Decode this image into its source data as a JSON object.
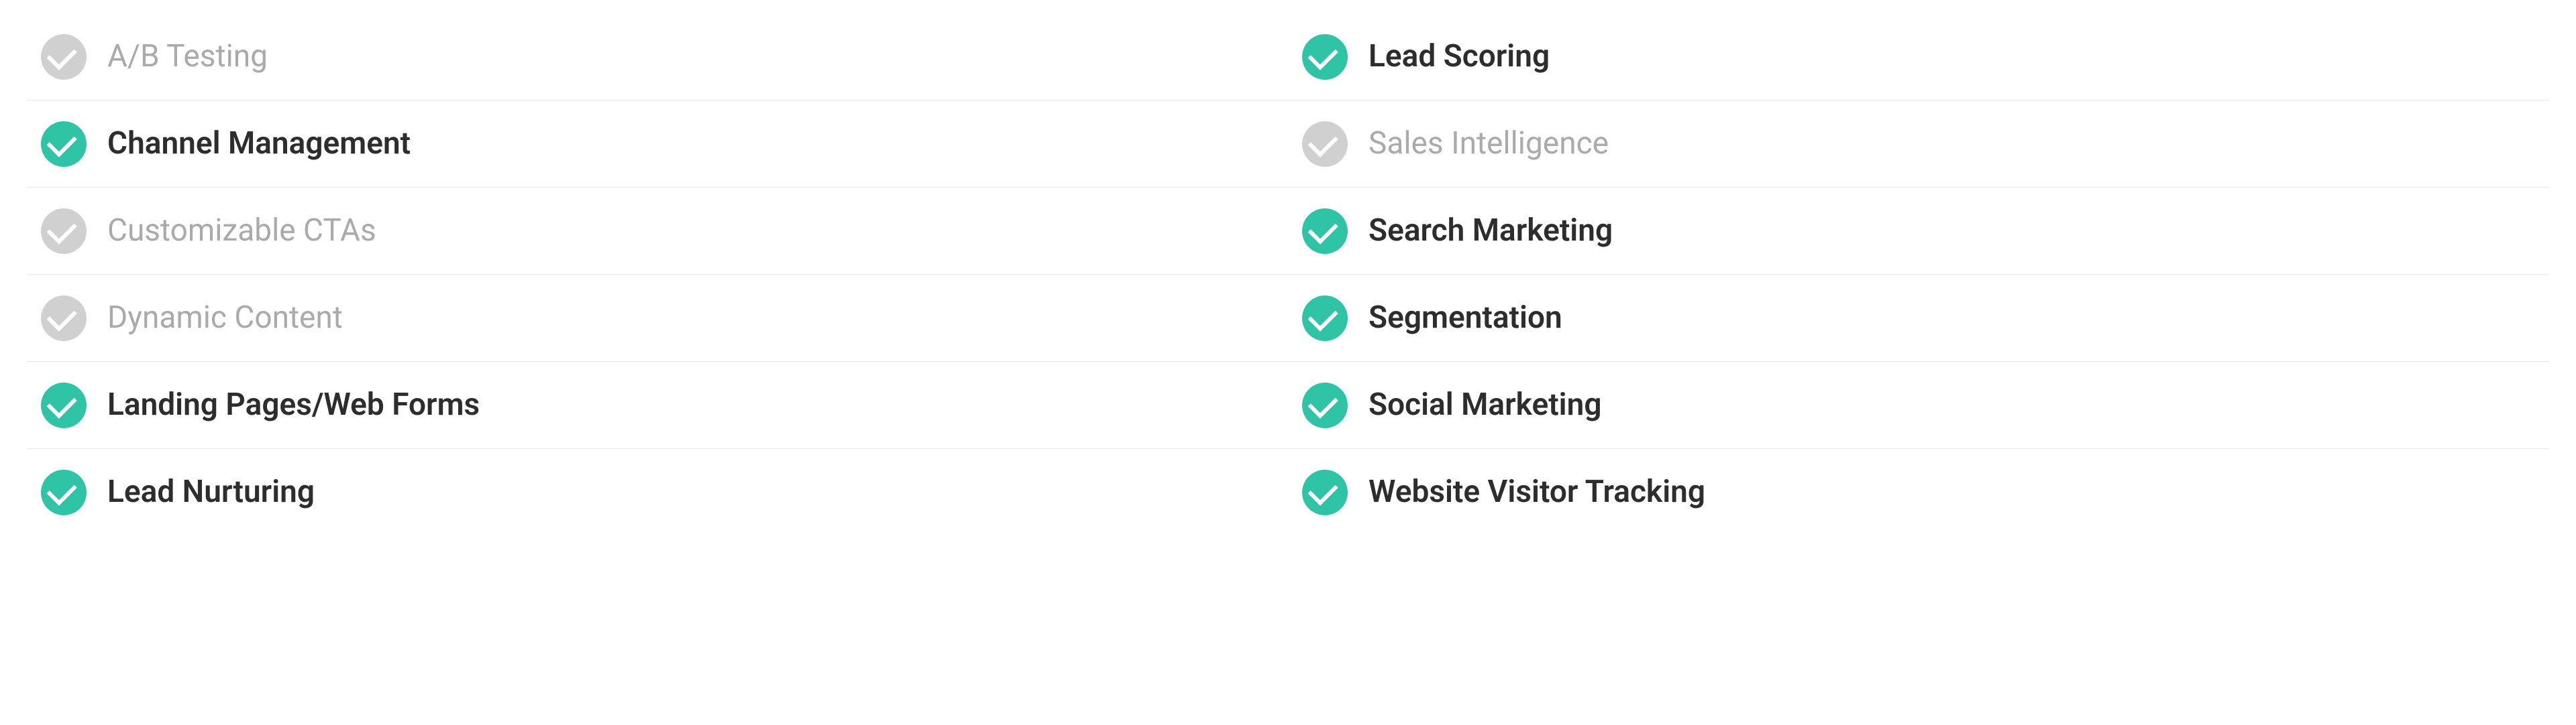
{
  "columns": [
    {
      "id": "left",
      "items": [
        {
          "id": "ab-testing",
          "label": "A/B Testing",
          "active": false
        },
        {
          "id": "channel-management",
          "label": "Channel Management",
          "active": true
        },
        {
          "id": "customizable-ctas",
          "label": "Customizable CTAs",
          "active": false
        },
        {
          "id": "dynamic-content",
          "label": "Dynamic Content",
          "active": false
        },
        {
          "id": "landing-pages",
          "label": "Landing Pages/Web Forms",
          "active": true
        },
        {
          "id": "lead-nurturing",
          "label": "Lead Nurturing",
          "active": true
        }
      ]
    },
    {
      "id": "right",
      "items": [
        {
          "id": "lead-scoring",
          "label": "Lead Scoring",
          "active": true
        },
        {
          "id": "sales-intelligence",
          "label": "Sales Intelligence",
          "active": false
        },
        {
          "id": "search-marketing",
          "label": "Search Marketing",
          "active": true
        },
        {
          "id": "segmentation",
          "label": "Segmentation",
          "active": true
        },
        {
          "id": "social-marketing",
          "label": "Social Marketing",
          "active": true
        },
        {
          "id": "website-visitor-tracking",
          "label": "Website Visitor Tracking",
          "active": true
        }
      ]
    }
  ]
}
